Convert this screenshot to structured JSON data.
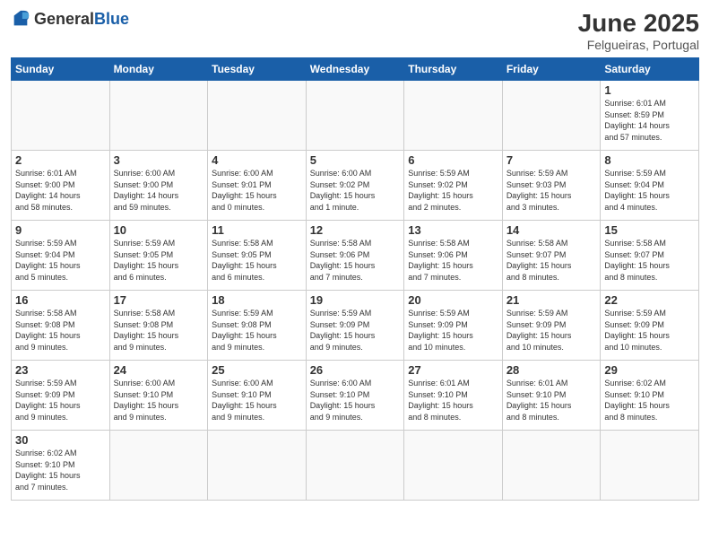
{
  "header": {
    "logo_general": "General",
    "logo_blue": "Blue",
    "month_title": "June 2025",
    "location": "Felgueiras, Portugal"
  },
  "weekdays": [
    "Sunday",
    "Monday",
    "Tuesday",
    "Wednesday",
    "Thursday",
    "Friday",
    "Saturday"
  ],
  "days": [
    {
      "day": "",
      "info": ""
    },
    {
      "day": "",
      "info": ""
    },
    {
      "day": "",
      "info": ""
    },
    {
      "day": "",
      "info": ""
    },
    {
      "day": "",
      "info": ""
    },
    {
      "day": "",
      "info": ""
    },
    {
      "day": "1",
      "info": "Sunrise: 6:01 AM\nSunset: 8:59 PM\nDaylight: 14 hours\nand 57 minutes."
    },
    {
      "day": "2",
      "info": "Sunrise: 6:01 AM\nSunset: 9:00 PM\nDaylight: 14 hours\nand 58 minutes."
    },
    {
      "day": "3",
      "info": "Sunrise: 6:00 AM\nSunset: 9:00 PM\nDaylight: 14 hours\nand 59 minutes."
    },
    {
      "day": "4",
      "info": "Sunrise: 6:00 AM\nSunset: 9:01 PM\nDaylight: 15 hours\nand 0 minutes."
    },
    {
      "day": "5",
      "info": "Sunrise: 6:00 AM\nSunset: 9:02 PM\nDaylight: 15 hours\nand 1 minute."
    },
    {
      "day": "6",
      "info": "Sunrise: 5:59 AM\nSunset: 9:02 PM\nDaylight: 15 hours\nand 2 minutes."
    },
    {
      "day": "7",
      "info": "Sunrise: 5:59 AM\nSunset: 9:03 PM\nDaylight: 15 hours\nand 3 minutes."
    },
    {
      "day": "8",
      "info": "Sunrise: 5:59 AM\nSunset: 9:04 PM\nDaylight: 15 hours\nand 4 minutes."
    },
    {
      "day": "9",
      "info": "Sunrise: 5:59 AM\nSunset: 9:04 PM\nDaylight: 15 hours\nand 5 minutes."
    },
    {
      "day": "10",
      "info": "Sunrise: 5:59 AM\nSunset: 9:05 PM\nDaylight: 15 hours\nand 6 minutes."
    },
    {
      "day": "11",
      "info": "Sunrise: 5:58 AM\nSunset: 9:05 PM\nDaylight: 15 hours\nand 6 minutes."
    },
    {
      "day": "12",
      "info": "Sunrise: 5:58 AM\nSunset: 9:06 PM\nDaylight: 15 hours\nand 7 minutes."
    },
    {
      "day": "13",
      "info": "Sunrise: 5:58 AM\nSunset: 9:06 PM\nDaylight: 15 hours\nand 7 minutes."
    },
    {
      "day": "14",
      "info": "Sunrise: 5:58 AM\nSunset: 9:07 PM\nDaylight: 15 hours\nand 8 minutes."
    },
    {
      "day": "15",
      "info": "Sunrise: 5:58 AM\nSunset: 9:07 PM\nDaylight: 15 hours\nand 8 minutes."
    },
    {
      "day": "16",
      "info": "Sunrise: 5:58 AM\nSunset: 9:08 PM\nDaylight: 15 hours\nand 9 minutes."
    },
    {
      "day": "17",
      "info": "Sunrise: 5:58 AM\nSunset: 9:08 PM\nDaylight: 15 hours\nand 9 minutes."
    },
    {
      "day": "18",
      "info": "Sunrise: 5:59 AM\nSunset: 9:08 PM\nDaylight: 15 hours\nand 9 minutes."
    },
    {
      "day": "19",
      "info": "Sunrise: 5:59 AM\nSunset: 9:09 PM\nDaylight: 15 hours\nand 9 minutes."
    },
    {
      "day": "20",
      "info": "Sunrise: 5:59 AM\nSunset: 9:09 PM\nDaylight: 15 hours\nand 10 minutes."
    },
    {
      "day": "21",
      "info": "Sunrise: 5:59 AM\nSunset: 9:09 PM\nDaylight: 15 hours\nand 10 minutes."
    },
    {
      "day": "22",
      "info": "Sunrise: 5:59 AM\nSunset: 9:09 PM\nDaylight: 15 hours\nand 10 minutes."
    },
    {
      "day": "23",
      "info": "Sunrise: 5:59 AM\nSunset: 9:09 PM\nDaylight: 15 hours\nand 9 minutes."
    },
    {
      "day": "24",
      "info": "Sunrise: 6:00 AM\nSunset: 9:10 PM\nDaylight: 15 hours\nand 9 minutes."
    },
    {
      "day": "25",
      "info": "Sunrise: 6:00 AM\nSunset: 9:10 PM\nDaylight: 15 hours\nand 9 minutes."
    },
    {
      "day": "26",
      "info": "Sunrise: 6:00 AM\nSunset: 9:10 PM\nDaylight: 15 hours\nand 9 minutes."
    },
    {
      "day": "27",
      "info": "Sunrise: 6:01 AM\nSunset: 9:10 PM\nDaylight: 15 hours\nand 8 minutes."
    },
    {
      "day": "28",
      "info": "Sunrise: 6:01 AM\nSunset: 9:10 PM\nDaylight: 15 hours\nand 8 minutes."
    },
    {
      "day": "29",
      "info": "Sunrise: 6:02 AM\nSunset: 9:10 PM\nDaylight: 15 hours\nand 8 minutes."
    },
    {
      "day": "30",
      "info": "Sunrise: 6:02 AM\nSunset: 9:10 PM\nDaylight: 15 hours\nand 7 minutes."
    },
    {
      "day": "",
      "info": ""
    },
    {
      "day": "",
      "info": ""
    },
    {
      "day": "",
      "info": ""
    },
    {
      "day": "",
      "info": ""
    },
    {
      "day": "",
      "info": ""
    }
  ]
}
